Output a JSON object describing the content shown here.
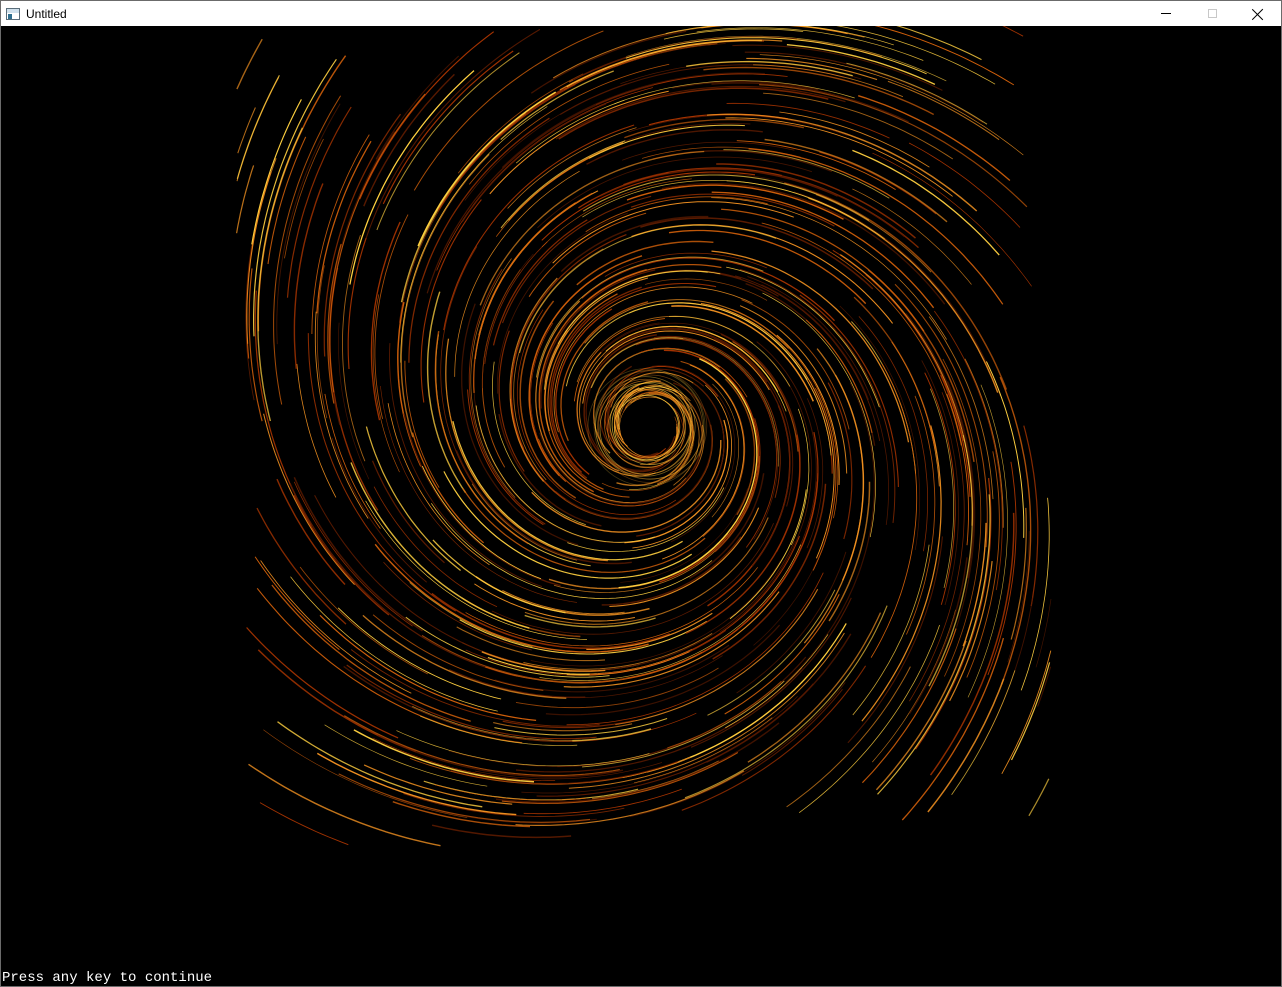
{
  "window": {
    "title": "Untitled",
    "icon": "app-window-icon",
    "controls": {
      "minimize_icon": "minimize-icon",
      "maximize_icon": "maximize-icon",
      "close_icon": "close-icon"
    }
  },
  "visualization": {
    "kind": "vortex-streamlines",
    "background": "#000000",
    "palette": [
      "#5a1a00",
      "#a83400",
      "#d2600a",
      "#f09020",
      "#ffd040"
    ],
    "center_hole_color": "#000000"
  },
  "console": {
    "prompt": "Press any key to continue"
  }
}
